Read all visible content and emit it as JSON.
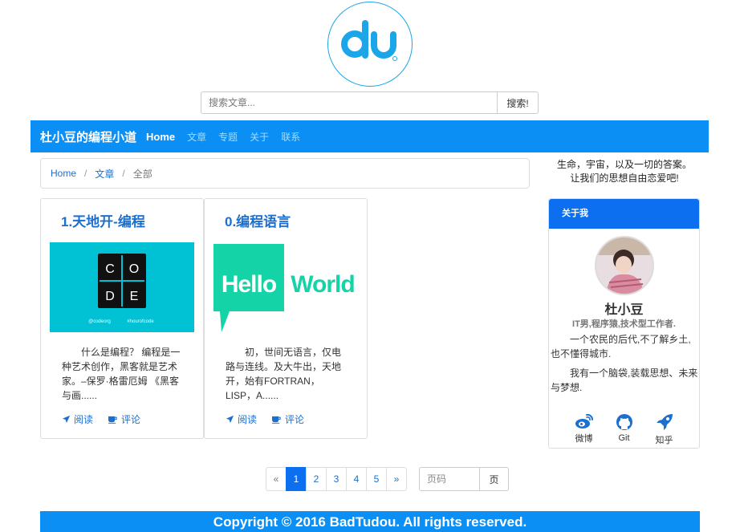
{
  "logo": {
    "text": "du",
    "brand_color": "#1aa6e8"
  },
  "search": {
    "placeholder": "搜索文章...",
    "button_label": "搜索!"
  },
  "navbar": {
    "brand": "杜小豆的编程小道",
    "links": [
      {
        "label": "Home",
        "active": true
      },
      {
        "label": "文章",
        "active": false
      },
      {
        "label": "专题",
        "active": false
      },
      {
        "label": "关于",
        "active": false
      },
      {
        "label": "联系",
        "active": false
      }
    ],
    "bg_color": "#0b8ff5"
  },
  "breadcrumb": {
    "items": [
      "Home",
      "文章",
      "全部"
    ],
    "separator": "/"
  },
  "articles": [
    {
      "title": "1.天地开-编程",
      "image": {
        "letters": [
          "C",
          "O",
          "D",
          "E"
        ],
        "tags": [
          "@codeorg",
          "#hourofcode"
        ],
        "bg_color": "#00c2d4"
      },
      "excerpt": "什么是编程？ 编程是一种艺术创作，黑客就是艺术家。–保罗·格雷厄姆 《黑客与画......",
      "read_label": "阅读",
      "comment_label": "评论"
    },
    {
      "title": "0.编程语言",
      "image": {
        "words": [
          "Hello",
          "World"
        ],
        "color": "#14d3a6"
      },
      "excerpt": "初，世间无语言，仅电路与连线。及大牛出，天地开，始有FORTRAN，LISP，A......",
      "read_label": "阅读",
      "comment_label": "评论"
    }
  ],
  "sidebar": {
    "motto": [
      "生命，宇宙，以及一切的答案。",
      "让我们的思想自由恋爱吧!"
    ],
    "about": {
      "heading": "关于我",
      "name": "杜小豆",
      "role": "IT男,程序猿,技术型工作者.",
      "paragraphs": [
        "一个农民的后代,不了解乡土,也不懂得城市.",
        "我有一个脑袋,装载思想、未来与梦想."
      ],
      "socials": [
        {
          "icon": "weibo-icon",
          "label": "微博"
        },
        {
          "icon": "github-icon",
          "label": "Git"
        },
        {
          "icon": "rocket-icon",
          "label": "知乎"
        }
      ]
    }
  },
  "pagination": {
    "prev": "«",
    "pages": [
      "1",
      "2",
      "3",
      "4",
      "5"
    ],
    "current": "1",
    "next": "»",
    "jump_placeholder": "页码",
    "jump_button": "页"
  },
  "footer": {
    "text": "Copyright © 2016 BadTudou. All rights reserved."
  }
}
